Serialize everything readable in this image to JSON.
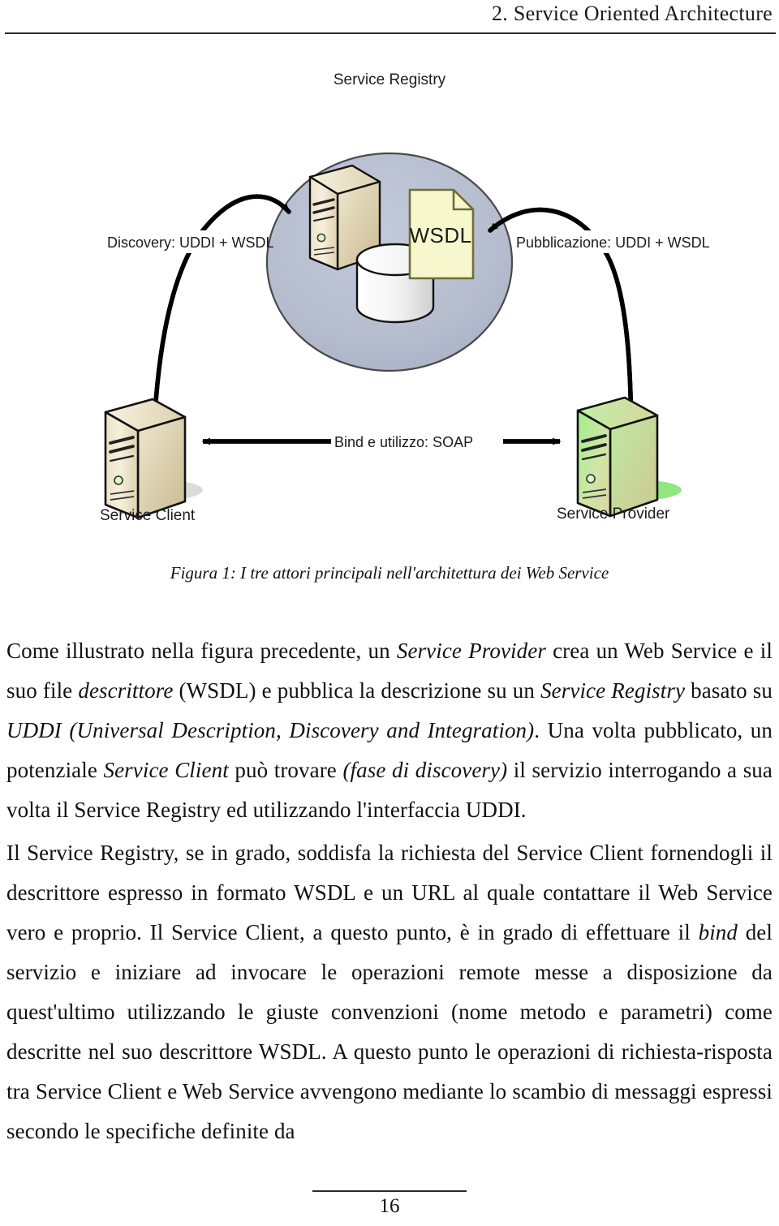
{
  "header": {
    "title": "2. Service Oriented Architecture"
  },
  "figure": {
    "registry_label": "Service Registry",
    "document_label": "WSDL",
    "discovery_label": "Discovery: UDDI + WSDL",
    "publication_label": "Pubblicazione: UDDI + WSDL",
    "bind_label": "Bind e utilizzo: SOAP",
    "client_label": "Service Client",
    "provider_label": "Service Provider",
    "caption": "Figura 1: I tre attori principali nell'architettura dei Web Service",
    "colors": {
      "registry_cloud": "#b4bccd",
      "registry_cloud_stroke": "#3a3a3a",
      "server_beige_light": "#f3ead2",
      "server_beige_dark": "#cdc09a",
      "database_light": "#ffffff",
      "database_shade": "#d8d8d8",
      "wsdl_doc_fill": "#f7f7cd",
      "wsdl_doc_stroke": "#7a7a36",
      "provider_green_light": "#a8f09a",
      "provider_green_dark": "#cfd9a0",
      "provider_shadow": "#7ce26a",
      "arrow": "#000000"
    }
  },
  "body": {
    "paragraph_1_html": "Come illustrato nella figura precedente, un <em>Service Provider</em> crea un Web Service e il suo file <em>descrittore</em> (WSDL) e pubblica la descrizione su un <em>Service Registry</em> basato su <em>UDDI (Universal Description, Discovery and Integration)</em>. Una volta pubblicato, un potenziale <em>Service Client</em> può trovare <em>(fase di discovery)</em> il servizio interrogando a sua volta il Service Registry ed utilizzando l'interfaccia UDDI.",
    "paragraph_2_html": "Il Service Registry, se in grado, soddisfa la richiesta del Service Client fornendogli il descrittore espresso in formato WSDL e un URL al quale contattare il Web Service vero e proprio. Il Service Client, a questo punto, è in grado di effettuare il <em>bind</em> del servizio e iniziare ad invocare le operazioni remote messe a disposizione da quest'ultimo utilizzando le giuste convenzioni (nome metodo e parametri) come descritte nel suo descrittore WSDL. A questo punto le operazioni di richiesta-risposta tra Service Client e Web Service avvengono mediante lo scambio di messaggi espressi secondo le specifiche definite da"
  },
  "footer": {
    "page_number": "16"
  }
}
